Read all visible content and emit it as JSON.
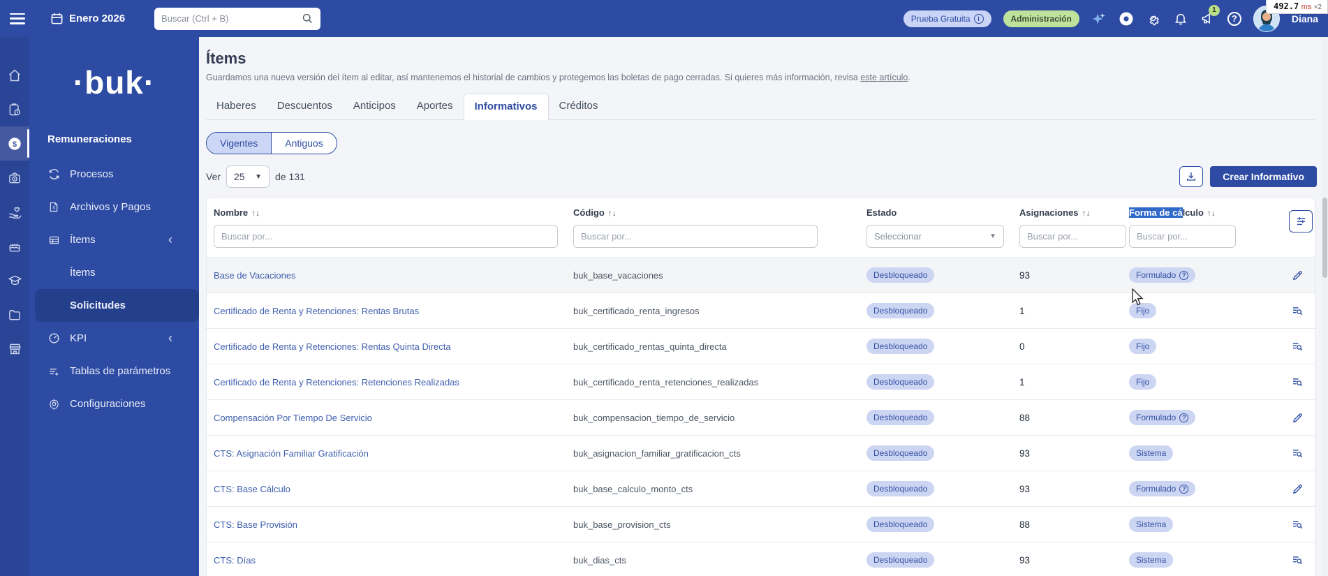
{
  "topbar": {
    "period": "Enero 2026",
    "search_placeholder": "Buscar (Ctrl + B)",
    "trial_badge": "Prueba Gratuita",
    "admin_badge": "Administración",
    "notification_count": "1",
    "help_label": "?",
    "user_name": "Diana",
    "perf_overlay": {
      "time": "492.7",
      "unit": "ms",
      "multiplier": "×2"
    }
  },
  "sidebar": {
    "logo": "·buk·",
    "section": "Remuneraciones",
    "items": [
      {
        "label": "Procesos"
      },
      {
        "label": "Archivos y Pagos"
      },
      {
        "label": "Ítems"
      },
      {
        "label": "Ítems"
      },
      {
        "label": "Solicitudes"
      },
      {
        "label": "KPI"
      },
      {
        "label": "Tablas de parámetros"
      },
      {
        "label": "Configuraciones"
      }
    ]
  },
  "page": {
    "title": "Ítems",
    "description": "Guardamos una nueva versión del ítem al editar, así mantenemos el historial de cambios y protegemos las boletas de pago cerradas. Si quieres más información, revisa ",
    "description_link": "este artículo",
    "description_end": ".",
    "tabs": [
      {
        "label": "Haberes"
      },
      {
        "label": "Descuentos"
      },
      {
        "label": "Anticipos"
      },
      {
        "label": "Aportes"
      },
      {
        "label": "Informativos"
      },
      {
        "label": "Créditos"
      }
    ],
    "active_tab": "Informativos",
    "toggle": {
      "on": "Vigentes",
      "off": "Antiguos"
    },
    "pagination": {
      "prefix": "Ver",
      "page_size": "25",
      "suffix": "de 131"
    },
    "create_button": "Crear Informativo"
  },
  "table": {
    "columns": {
      "name": "Nombre",
      "code": "Código",
      "status": "Estado",
      "assignments": "Asignaciones",
      "calc_selected_part": "Forma de cá",
      "calc_rest_part": "lculo"
    },
    "filter_placeholder": "Buscar por...",
    "select_placeholder": "Seleccionar",
    "rows": [
      {
        "name": "Base de Vacaciones",
        "code": "buk_base_vacaciones",
        "status": "Desbloqueado",
        "assignments": "93",
        "calc": "Formulado",
        "calc_info": true,
        "action": "edit",
        "hovered": true
      },
      {
        "name": "Certificado de Renta y Retenciones: Rentas Brutas",
        "code": "buk_certificado_renta_ingresos",
        "status": "Desbloqueado",
        "assignments": "1",
        "calc": "Fijo",
        "calc_info": false,
        "action": "view",
        "hovered": false
      },
      {
        "name": "Certificado de Renta y Retenciones: Rentas Quinta Directa",
        "code": "buk_certificado_rentas_quinta_directa",
        "status": "Desbloqueado",
        "assignments": "0",
        "calc": "Fijo",
        "calc_info": false,
        "action": "view",
        "hovered": false
      },
      {
        "name": "Certificado de Renta y Retenciones: Retenciones Realizadas",
        "code": "buk_certificado_renta_retenciones_realizadas",
        "status": "Desbloqueado",
        "assignments": "1",
        "calc": "Fijo",
        "calc_info": false,
        "action": "view",
        "hovered": false
      },
      {
        "name": "Compensación Por Tiempo De Servicio",
        "code": "buk_compensacion_tiempo_de_servicio",
        "status": "Desbloqueado",
        "assignments": "88",
        "calc": "Formulado",
        "calc_info": true,
        "action": "edit",
        "hovered": false
      },
      {
        "name": "CTS: Asignación Familiar Gratificación",
        "code": "buk_asignacion_familiar_gratificacion_cts",
        "status": "Desbloqueado",
        "assignments": "93",
        "calc": "Sistema",
        "calc_info": false,
        "action": "view",
        "hovered": false
      },
      {
        "name": "CTS: Base Cálculo",
        "code": "buk_base_calculo_monto_cts",
        "status": "Desbloqueado",
        "assignments": "93",
        "calc": "Formulado",
        "calc_info": true,
        "action": "edit",
        "hovered": false
      },
      {
        "name": "CTS: Base Provisión",
        "code": "buk_base_provision_cts",
        "status": "Desbloqueado",
        "assignments": "88",
        "calc": "Sistema",
        "calc_info": false,
        "action": "view",
        "hovered": false
      },
      {
        "name": "CTS: Días",
        "code": "buk_dias_cts",
        "status": "Desbloqueado",
        "assignments": "93",
        "calc": "Sistema",
        "calc_info": false,
        "action": "view",
        "hovered": false
      }
    ]
  },
  "colors": {
    "topbar_blue": "#2d4ba3",
    "rail_blue": "#2a4596",
    "selected_menu": "#24408c",
    "badge_bg": "#ccd5f2",
    "badge_text": "#3452a5",
    "trial_pill_bg": "#c9d4f6",
    "admin_pill_bg": "#bee29b",
    "link_blue": "#3f5fae",
    "selection_highlight": "#3069c9",
    "content_bg": "#f4f5f8"
  }
}
